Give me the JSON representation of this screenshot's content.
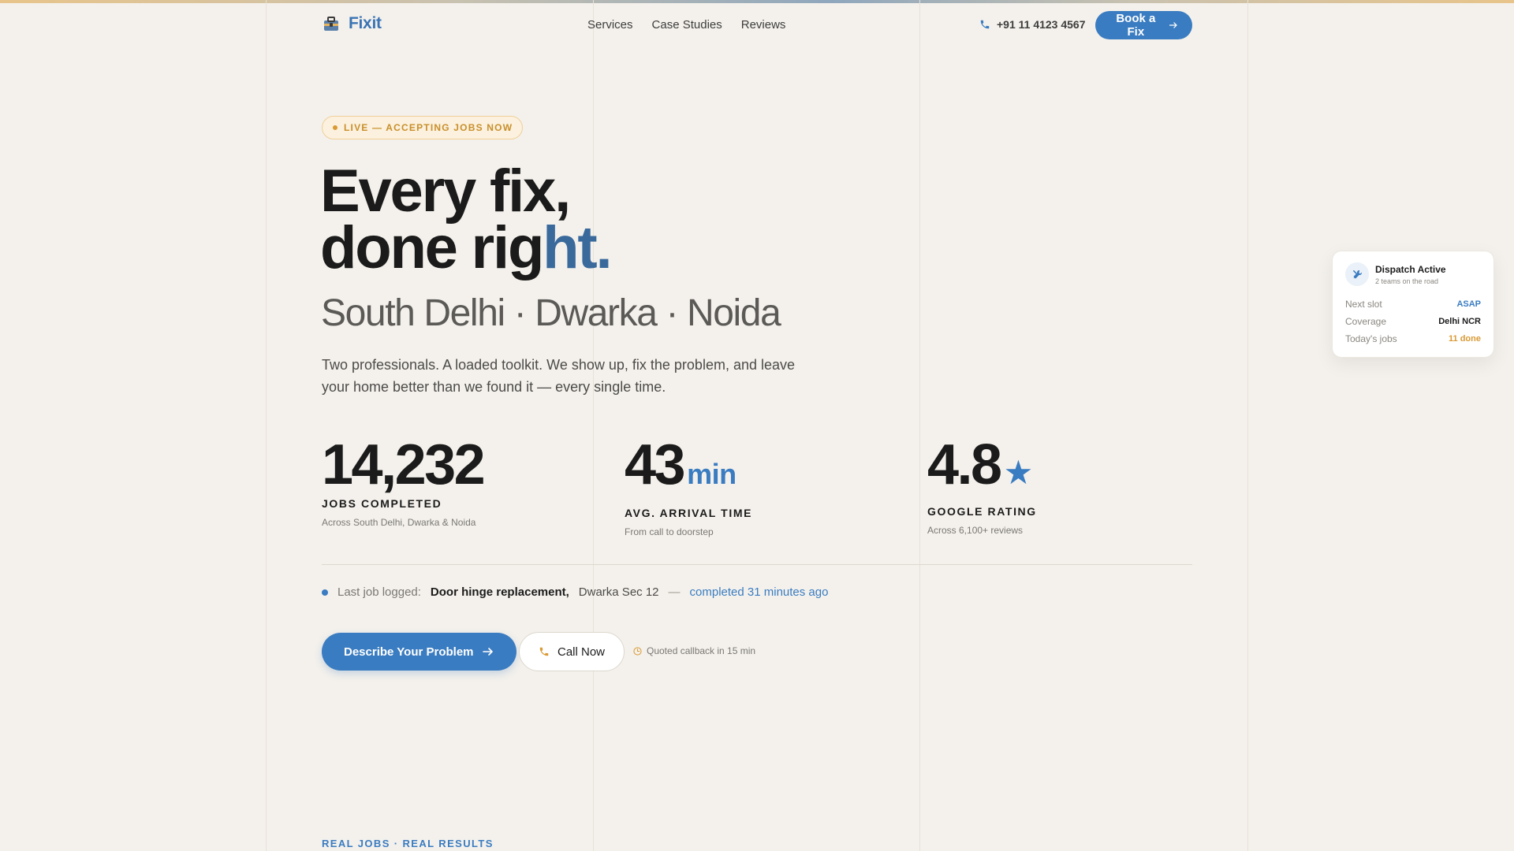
{
  "brand": {
    "name": "Fixit"
  },
  "nav": {
    "items": [
      "Services",
      "Case Studies",
      "Reviews"
    ]
  },
  "header": {
    "phone": "+91 11 4123 4567",
    "book_label": "Book a Fix"
  },
  "hero": {
    "badge": "LIVE — ACCEPTING JOBS NOW",
    "headline_line1": "Every fix,",
    "headline_line2_plain": "done rig",
    "headline_line2_accent": "ht.",
    "areas": "South Delhi · Dwarka · Noida",
    "lede": "Two professionals. A loaded toolkit. We show up, fix the problem, and leave your home better than we found it — every single time."
  },
  "stats": [
    {
      "value": "14,232",
      "unit": "",
      "label": "JOBS COMPLETED",
      "sub": "Across South Delhi, Dwarka & Noida"
    },
    {
      "value": "43",
      "unit": "min",
      "label": "AVG. ARRIVAL TIME",
      "sub": "From call to doorstep"
    },
    {
      "value": "4.8",
      "unit": "★",
      "label": "GOOGLE RATING",
      "sub": "Across 6,100+ reviews"
    }
  ],
  "last_job": {
    "prefix": "Last job logged:",
    "job": "Door hinge replacement,",
    "location": "Dwarka Sec 12",
    "separator": "—",
    "when": "completed 31 minutes ago"
  },
  "cta": {
    "primary": "Describe Your Problem",
    "secondary": "Call Now",
    "note": "Quoted callback in 15 min"
  },
  "section": {
    "eyebrow": "REAL JOBS · REAL RESULTS"
  },
  "dispatch_card": {
    "title": "Dispatch Active",
    "subtitle": "2 teams on the road",
    "rows": [
      {
        "key": "Next slot",
        "value": "ASAP"
      },
      {
        "key": "Coverage",
        "value": "Delhi NCR"
      },
      {
        "key": "Today's jobs",
        "value": "11 done"
      }
    ]
  },
  "colors": {
    "accent": "#3a7cc1",
    "gold": "#d99a35",
    "background": "#f4f1ec"
  },
  "icons": {
    "logo": "toolbox-icon",
    "phone": "phone-icon",
    "arrow": "arrow-right-icon",
    "dispatch": "tools-icon",
    "clock": "clock-icon"
  }
}
